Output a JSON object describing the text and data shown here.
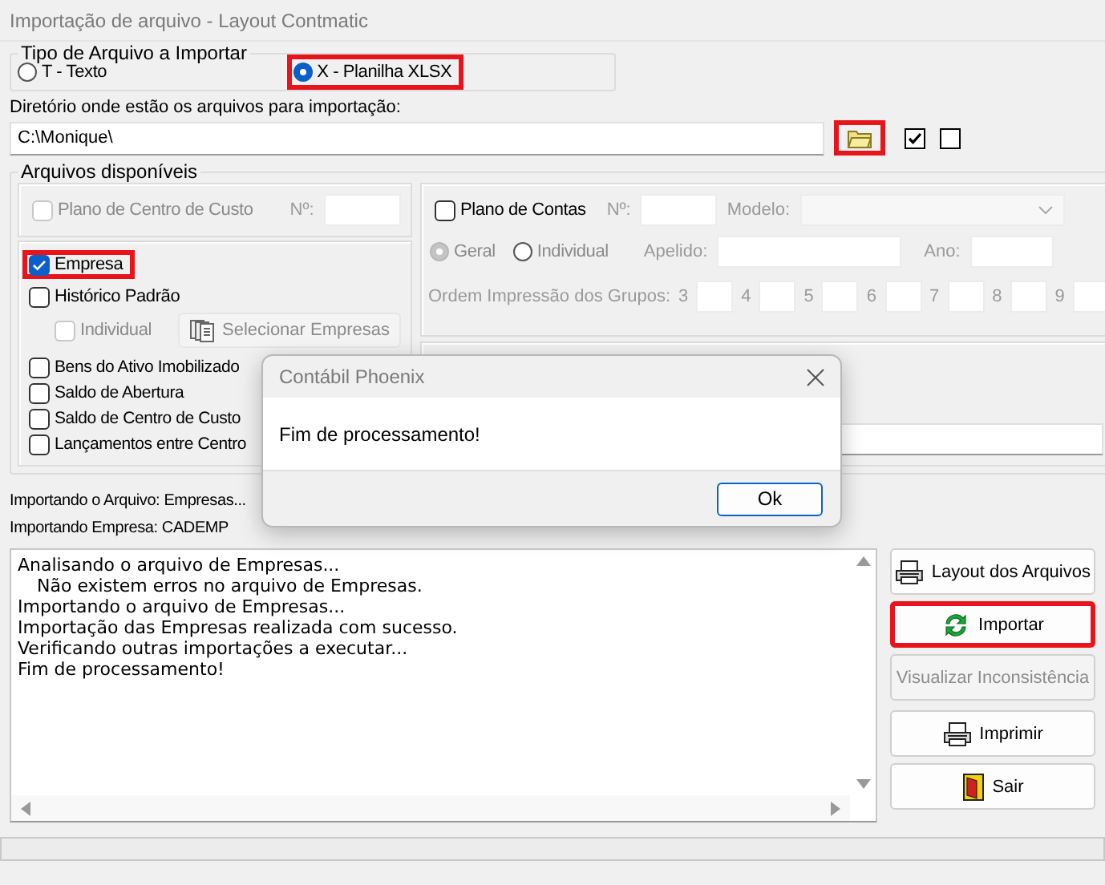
{
  "window": {
    "title": "Importação de arquivo - Layout Contmatic"
  },
  "file_type": {
    "legend": "Tipo de Arquivo a Importar",
    "options": [
      {
        "label": "T - Texto",
        "selected": false,
        "highlighted": false
      },
      {
        "label": "X - Planilha XLSX",
        "selected": true,
        "highlighted": true
      }
    ]
  },
  "directory": {
    "label": "Diretório onde estão os arquivos para importação:",
    "value": "C:\\Monique\\",
    "browse_highlighted": true,
    "options": [
      {
        "checked": true
      },
      {
        "checked": false
      }
    ]
  },
  "available": {
    "legend": "Arquivos disponíveis",
    "cost_center_plan": {
      "label": "Plano de Centro de Custo",
      "checked": false,
      "disabled": true,
      "number_label": "Nº:"
    },
    "files": [
      {
        "label": "Empresa",
        "checked": true,
        "highlighted": true
      },
      {
        "label": "Histórico Padrão",
        "checked": false,
        "highlighted": false
      }
    ],
    "individual": {
      "label": "Individual",
      "checked": false,
      "disabled": true
    },
    "select_button": {
      "label": "Selecionar Empresas",
      "disabled": true
    },
    "more_files": [
      {
        "label": "Bens do Ativo Imobilizado",
        "checked": false
      },
      {
        "label": "Saldo de Abertura",
        "checked": false
      },
      {
        "label": "Saldo de Centro de Custo",
        "checked": false
      },
      {
        "label": "Lançamentos entre Centro",
        "checked": false
      }
    ],
    "chart_of_accounts": {
      "label": "Plano de Contas",
      "checked": false,
      "fields_disabled": true,
      "number_label": "Nº:",
      "model_label": "Modelo:",
      "scope": [
        {
          "label": "Geral",
          "selected": true
        },
        {
          "label": "Individual",
          "selected": false
        }
      ],
      "nickname_label": "Apelido:",
      "year_label": "Ano:",
      "group_order_label": "Ordem Impressão dos Grupos:",
      "group_numbers": [
        "3",
        "4",
        "5",
        "6",
        "7",
        "8",
        "9"
      ]
    }
  },
  "status_lines": [
    "Importando o Arquivo: Empresas...",
    "Importando Empresa: CADEMP"
  ],
  "log": [
    {
      "text": "Analisando o arquivo de Empresas...",
      "indented": false
    },
    {
      "text": "Não existem erros no arquivo de Empresas.",
      "indented": true
    },
    {
      "text": "Importando o arquivo de Empresas...",
      "indented": false
    },
    {
      "text": "Importação das Empresas realizada com sucesso.",
      "indented": false
    },
    {
      "text": "Verificando outras importações a executar...",
      "indented": false
    },
    {
      "text": "Fim de processamento!",
      "indented": false
    }
  ],
  "buttons": [
    {
      "label": "Layout dos Arquivos",
      "kind": "printer",
      "disabled": false,
      "highlighted": false
    },
    {
      "label": "Importar",
      "kind": "refresh",
      "disabled": false,
      "highlighted": true
    },
    {
      "label": "Visualizar Inconsistência",
      "kind": "plain",
      "disabled": true,
      "highlighted": false
    },
    {
      "label": "Imprimir",
      "kind": "printer",
      "disabled": false,
      "highlighted": false
    },
    {
      "label": "Sair",
      "kind": "exit",
      "disabled": false,
      "highlighted": false
    }
  ],
  "dialog": {
    "title": "Contábil Phoenix",
    "message": "Fim de processamento!",
    "button": "Ok"
  }
}
